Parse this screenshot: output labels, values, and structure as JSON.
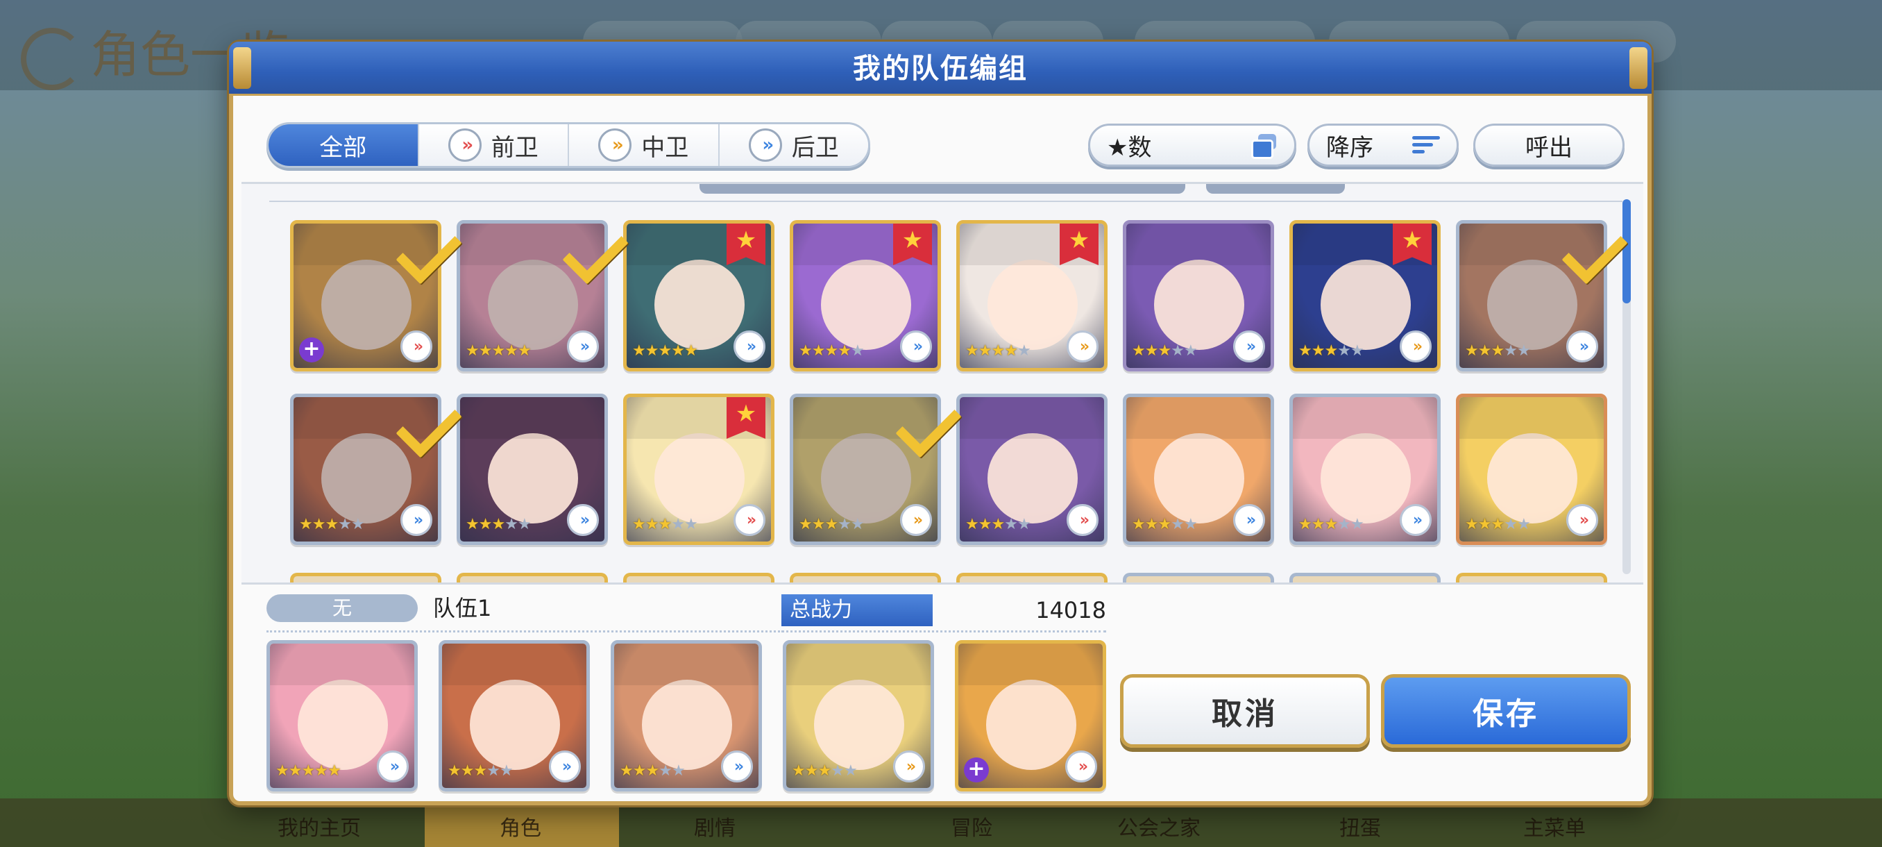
{
  "background": {
    "title": "角色一览",
    "bottom_nav": [
      "我的主页",
      "角色",
      "剧情",
      "冒险",
      "公会之家",
      "扭蛋",
      "主菜单"
    ]
  },
  "dialog": {
    "title": "我的队伍编组",
    "role_tabs": [
      {
        "label": "全部",
        "icon": "none",
        "active": true
      },
      {
        "label": "前卫",
        "icon": "front-position-icon",
        "active": false
      },
      {
        "label": "中卫",
        "icon": "middle-position-icon",
        "active": false
      },
      {
        "label": "后卫",
        "icon": "back-position-icon",
        "active": false
      }
    ],
    "filter_star_label": "★数",
    "sort_label": "降序",
    "call_label": "呼出",
    "role_glyph": "»",
    "star_glyph": "★",
    "favorite_glyph": "★",
    "plus_glyph": "+",
    "roster": [
      {
        "stars": 0,
        "max_stars": 0,
        "position": "front",
        "frame": "gold",
        "favorite": false,
        "selected": true,
        "plus": true,
        "color": "#e9a74b"
      },
      {
        "stars": 5,
        "max_stars": 5,
        "position": "back",
        "frame": "silver",
        "favorite": false,
        "selected": true,
        "plus": false,
        "color": "#f1a4b8"
      },
      {
        "stars": 5,
        "max_stars": 5,
        "position": "back",
        "frame": "gold",
        "favorite": true,
        "selected": false,
        "plus": false,
        "color": "#3f6d74"
      },
      {
        "stars": 4,
        "max_stars": 5,
        "position": "back",
        "frame": "gold",
        "favorite": true,
        "selected": false,
        "plus": false,
        "color": "#9b6ad1"
      },
      {
        "stars": 4,
        "max_stars": 5,
        "position": "mid",
        "frame": "gold",
        "favorite": true,
        "selected": false,
        "plus": false,
        "color": "#efe7e2"
      },
      {
        "stars": 3,
        "max_stars": 5,
        "position": "back",
        "frame": "purple",
        "favorite": false,
        "selected": false,
        "plus": false,
        "color": "#7b5bb3"
      },
      {
        "stars": 3,
        "max_stars": 5,
        "position": "mid",
        "frame": "gold",
        "favorite": true,
        "selected": false,
        "plus": false,
        "color": "#2d3f8f"
      },
      {
        "stars": 3,
        "max_stars": 5,
        "position": "back",
        "frame": "silver",
        "favorite": false,
        "selected": true,
        "plus": false,
        "color": "#d79470"
      },
      {
        "stars": 3,
        "max_stars": 5,
        "position": "back",
        "frame": "silver",
        "favorite": false,
        "selected": true,
        "plus": false,
        "color": "#c96f4a"
      },
      {
        "stars": 3,
        "max_stars": 5,
        "position": "back",
        "frame": "silver",
        "favorite": false,
        "selected": false,
        "plus": false,
        "color": "#5c3d5a"
      },
      {
        "stars": 3,
        "max_stars": 5,
        "position": "front",
        "frame": "gold",
        "favorite": true,
        "selected": false,
        "plus": false,
        "color": "#f6e6b0"
      },
      {
        "stars": 3,
        "max_stars": 5,
        "position": "mid",
        "frame": "silver",
        "favorite": false,
        "selected": true,
        "plus": false,
        "color": "#e9cf7c"
      },
      {
        "stars": 3,
        "max_stars": 5,
        "position": "front",
        "frame": "silver",
        "favorite": false,
        "selected": false,
        "plus": false,
        "color": "#7a5aa8"
      },
      {
        "stars": 3,
        "max_stars": 5,
        "position": "back",
        "frame": "silver",
        "favorite": false,
        "selected": false,
        "plus": false,
        "color": "#f0a76a"
      },
      {
        "stars": 3,
        "max_stars": 5,
        "position": "back",
        "frame": "silver",
        "favorite": false,
        "selected": false,
        "plus": false,
        "color": "#f2b7bf"
      },
      {
        "stars": 3,
        "max_stars": 5,
        "position": "front",
        "frame": "bronze",
        "favorite": false,
        "selected": false,
        "plus": false,
        "color": "#f4cf63"
      }
    ],
    "team": {
      "tag": "无",
      "name": "队伍1",
      "power_label": "总战力",
      "power_value": "14018",
      "members": [
        {
          "stars": 5,
          "max_stars": 5,
          "position": "back",
          "frame": "silver",
          "plus": false,
          "color": "#f1a4b8"
        },
        {
          "stars": 3,
          "max_stars": 5,
          "position": "back",
          "frame": "silver",
          "plus": false,
          "color": "#c96f4a"
        },
        {
          "stars": 3,
          "max_stars": 5,
          "position": "back",
          "frame": "silver",
          "plus": false,
          "color": "#d79470"
        },
        {
          "stars": 3,
          "max_stars": 5,
          "position": "mid",
          "frame": "silver",
          "plus": false,
          "color": "#e9cf7c"
        },
        {
          "stars": 0,
          "max_stars": 0,
          "position": "front",
          "frame": "gold",
          "plus": true,
          "color": "#e9a74b"
        }
      ]
    },
    "cancel_label": "取消",
    "save_label": "保存"
  }
}
